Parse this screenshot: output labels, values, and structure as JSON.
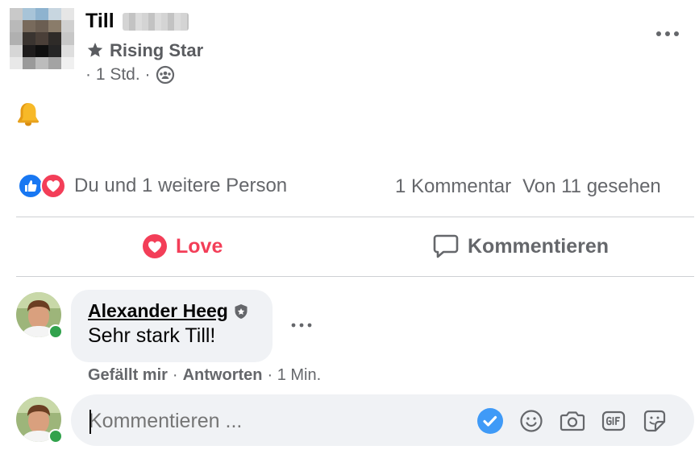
{
  "post": {
    "author_first_name": "Till",
    "badge": "Rising Star",
    "time": "· 1 Std. ·",
    "emoji": "🔔",
    "reactions_text": "Du und 1 weitere Person",
    "comment_count": "1 Kommentar",
    "seen_count": "Von 11 gesehen"
  },
  "actions": {
    "love": "Love",
    "comment": "Kommentieren"
  },
  "comment": {
    "author": "Alexander Heeg",
    "text": "Sehr stark Till!",
    "like": "Gefällt mir",
    "separator1": "·",
    "reply": "Antworten",
    "time": "· 1 Min."
  },
  "composer": {
    "placeholder": "Kommentieren ..."
  },
  "colors": {
    "love": "#f33e58",
    "like": "#1877f2",
    "online": "#31a24c"
  }
}
